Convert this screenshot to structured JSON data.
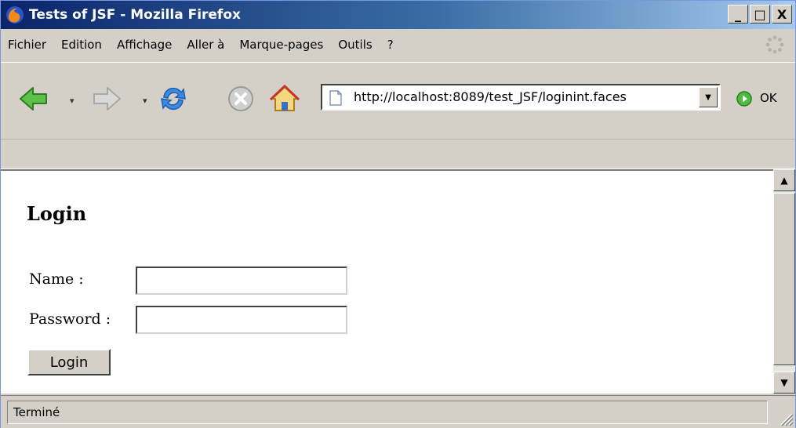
{
  "window": {
    "title": "Tests of JSF - Mozilla Firefox",
    "controls": {
      "minimize": "_",
      "maximize": "□",
      "close": "X"
    }
  },
  "menu": {
    "items": [
      {
        "label": "Fichier",
        "name": "menu-fichier"
      },
      {
        "label": "Edition",
        "name": "menu-edition"
      },
      {
        "label": "Affichage",
        "name": "menu-affichage"
      },
      {
        "label": "Aller à",
        "name": "menu-aller-a"
      },
      {
        "label": "Marque-pages",
        "name": "menu-marque-pages"
      },
      {
        "label": "Outils",
        "name": "menu-outils"
      },
      {
        "label": "?",
        "name": "menu-help"
      }
    ]
  },
  "toolbar": {
    "icons": [
      "back-icon",
      "forward-icon",
      "reload-icon",
      "stop-icon",
      "home-icon"
    ],
    "url": "http://localhost:8089/test_JSF/loginint.faces",
    "go_label": "OK"
  },
  "page": {
    "heading": "Login",
    "name_label": "Name :",
    "password_label": "Password :",
    "name_value": "",
    "password_value": "",
    "login_button": "Login"
  },
  "status": {
    "text": "Terminé"
  },
  "colors": {
    "titlebar_start": "#0a246a",
    "titlebar_end": "#a6caf0",
    "chrome": "#d4d0c8",
    "back_arrow": "#4caf3a",
    "reload_blue": "#2f7fd6",
    "go_green": "#3aa83a"
  }
}
